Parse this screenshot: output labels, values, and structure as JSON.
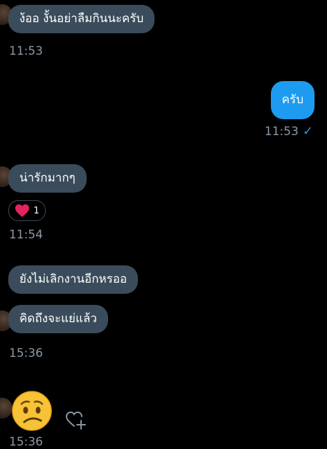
{
  "messages": [
    {
      "text": "ง้ออ งั้นอย่าลืมกินนะครับ"
    },
    {
      "text": "ครับ"
    },
    {
      "text": "น่ารักมากๆ"
    },
    {
      "text": "ยังไม่เลิกงานอีกหรออ"
    },
    {
      "text": "คิดถึงจะแย่แล้ว"
    }
  ],
  "timestamps": {
    "t1": "11:53",
    "t2": "11:53",
    "t3": "11:54",
    "t4": "15:36",
    "t5": "15:36"
  },
  "reaction": {
    "count": "1"
  },
  "icons": {
    "check": "✓",
    "heart": "heart-icon",
    "emoji": "worried-face-emoji",
    "add_reaction": "heart-plus-icon"
  },
  "colors": {
    "background": "#000000",
    "incoming_bubble": "#3a4c5b",
    "outgoing_bubble": "#1d9bf0",
    "timestamp": "#8b98a5"
  }
}
